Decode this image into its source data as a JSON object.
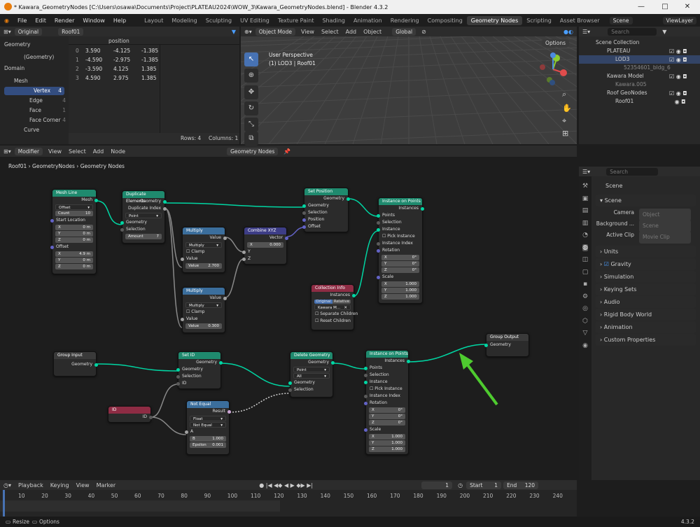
{
  "window": {
    "title": "* Kawara_GeometryNodes [C:\\Users\\osawa\\Documents\\Project\\PLATEAU2024\\WOW_3\\Kawara_GeometryNodes.blend] - Blender 4.3.2",
    "minimize": "—",
    "maximize": "□",
    "close": "✕"
  },
  "menu": {
    "items": [
      "File",
      "Edit",
      "Render",
      "Window",
      "Help"
    ],
    "workspaces": [
      "Layout",
      "Modeling",
      "Sculpting",
      "UV Editing",
      "Texture Paint",
      "Shading",
      "Animation",
      "Rendering",
      "Compositing",
      "Geometry Nodes",
      "Scripting",
      "Asset Browser"
    ],
    "active_workspace": "Geometry Nodes",
    "scene": "Scene",
    "view_layer": "ViewLayer"
  },
  "spreadsheet": {
    "mode": "Original",
    "object": "Roof01",
    "sidebar": {
      "geometry_label": "Geometry",
      "geometry_item": "(Geometry)",
      "domain_label": "Domain",
      "mesh": "Mesh",
      "items": [
        {
          "name": "Vertex",
          "count": "4"
        },
        {
          "name": "Edge",
          "count": "4"
        },
        {
          "name": "Face",
          "count": "1"
        },
        {
          "name": "Face Corner",
          "count": "4"
        }
      ],
      "curve": "Curve"
    },
    "column": "position",
    "rows": [
      [
        "0",
        "3.590",
        "-4.125",
        "-1.385"
      ],
      [
        "1",
        "-4.590",
        "-2.975",
        "-1.385"
      ],
      [
        "2",
        "-3.590",
        "4.125",
        "1.385"
      ],
      [
        "3",
        "4.590",
        "2.975",
        "1.385"
      ]
    ],
    "footer": {
      "rows": "Rows: 4",
      "columns": "Columns: 1"
    }
  },
  "viewport": {
    "mode": "Object Mode",
    "menus": [
      "View",
      "Select",
      "Add",
      "Object"
    ],
    "transform": "Global",
    "options": "Options",
    "perspective": "User Perspective",
    "collection": "(1) LOD3 | Roof01"
  },
  "outliner": {
    "search_placeholder": "Search",
    "title": "Scene Collection",
    "items": [
      {
        "name": "PLATEAU",
        "level": 0
      },
      {
        "name": "LOD3",
        "level": 1
      },
      {
        "name": "52354601_bldg_6",
        "level": 2
      },
      {
        "name": "Kawara Model",
        "level": 0
      },
      {
        "name": "Kawara.005",
        "level": 1
      },
      {
        "name": "Roof GeoNodes",
        "level": 0
      },
      {
        "name": "Roof01",
        "level": 1
      }
    ]
  },
  "properties": {
    "search_placeholder": "Search",
    "scene_name": "Scene",
    "scene_section": "Scene",
    "fields": [
      {
        "label": "Camera",
        "value": "Object"
      },
      {
        "label": "Background ...",
        "value": "Scene"
      },
      {
        "label": "Active Clip",
        "value": "Movie Clip"
      }
    ],
    "sections": [
      "Units",
      "Gravity",
      "Simulation",
      "Keying Sets",
      "Audio",
      "Rigid Body World",
      "Animation",
      "Custom Properties"
    ]
  },
  "node_editor": {
    "mode": "Modifier",
    "menus": [
      "View",
      "Select",
      "Add",
      "Node"
    ],
    "tree_name": "Geometry Nodes",
    "breadcrumb": [
      "Roof01",
      "GeometryNodes",
      "Geometry Nodes"
    ],
    "mesh_line": {
      "title": "Mesh Line",
      "out": "Mesh",
      "mode": "Offset",
      "count_label": "Count",
      "count": "10",
      "start": "Start Location",
      "sx": "0 m",
      "sy": "0 m",
      "sz": "0 m",
      "offset": "Offset",
      "ox": "4.9 m",
      "oy": "0 m",
      "oz": "0 m"
    },
    "dup": {
      "title": "Duplicate Elements",
      "geo": "Geometry",
      "idx": "Duplicate Index",
      "domain": "Point",
      "in_geo": "Geometry",
      "sel": "Selection",
      "amount": "Amount",
      "amount_v": "7"
    },
    "mul1": {
      "title": "Multiply",
      "out": "Value",
      "op": "Multiply",
      "clamp": "Clamp",
      "val": "Value",
      "v2": "2.700"
    },
    "mul2": {
      "title": "Multiply",
      "out": "Value",
      "op": "Multiply",
      "clamp": "Clamp",
      "val": "Value",
      "v2": "0.300"
    },
    "comb": {
      "title": "Combine XYZ",
      "out": "Vector",
      "x": "X",
      "xv": "0.000",
      "y": "Y",
      "z": "Z"
    },
    "setpos": {
      "title": "Set Position",
      "out": "Geometry",
      "geo": "Geometry",
      "sel": "Selection",
      "pos": "Position",
      "off": "Offset"
    },
    "iop1": {
      "title": "Instance on Points",
      "out": "Instances",
      "pts": "Points",
      "sel": "Selection",
      "inst": "Instance",
      "pick": "Pick Instance",
      "idx": "Instance Index",
      "rot": "Rotation",
      "rx": "0°",
      "ry": "0°",
      "rz": "0°",
      "scale": "Scale",
      "sx": "1.000",
      "sy": "1.000",
      "sz": "1.000"
    },
    "coll": {
      "title": "Collection Info",
      "out": "Instances",
      "orig": "Original",
      "rel": "Relative",
      "name": "Kawara M...",
      "sep": "Separate Children",
      "reset": "Reset Children"
    },
    "gin": {
      "title": "Group Input",
      "out": "Geometry"
    },
    "setid": {
      "title": "Set ID",
      "out": "Geometry",
      "geo": "Geometry",
      "sel": "Selection",
      "id": "ID"
    },
    "del": {
      "title": "Delete Geometry",
      "out": "Geometry",
      "dom": "Point",
      "mode": "All",
      "geo": "Geometry",
      "sel": "Selection"
    },
    "iop2": {
      "title": "Instance on Points",
      "out": "Instances",
      "pts": "Points",
      "sel": "Selection",
      "inst": "Instance",
      "pick": "Pick Instance",
      "idx": "Instance Index",
      "rot": "Rotation",
      "rx": "0°",
      "ry": "0°",
      "rz": "0°",
      "scale": "Scale",
      "sx": "1.000",
      "sy": "1.000",
      "sz": "1.000"
    },
    "gout": {
      "title": "Group Output",
      "in": "Geometry"
    },
    "idn": {
      "title": "ID",
      "out": "ID"
    },
    "neq": {
      "title": "Not Equal",
      "out": "Result",
      "type": "Float",
      "op": "Not Equal",
      "a": "A",
      "b": "B",
      "bv": "1.000",
      "eps": "Epsilon",
      "ev": "0.001"
    },
    "xyz": [
      "X",
      "Y",
      "Z"
    ]
  },
  "timeline": {
    "menus": [
      "Playback",
      "Keying",
      "View",
      "Marker"
    ],
    "frame": "1",
    "start_label": "Start",
    "start": "1",
    "end_label": "End",
    "end": "120",
    "ticks": [
      "10",
      "20",
      "30",
      "40",
      "50",
      "60",
      "70",
      "80",
      "90",
      "100",
      "110",
      "120",
      "130",
      "140",
      "150",
      "160",
      "170",
      "180",
      "190",
      "200",
      "210",
      "220",
      "230",
      "240"
    ]
  },
  "statusbar": {
    "resize": "Resize",
    "options": "Options",
    "version": "4.3.2"
  },
  "colors": {
    "geometry_header": "#1f8a6e",
    "input_header": "#2d7a8f",
    "utility_header": "#3b6e9c",
    "input_red": "#8e2c44",
    "link": "#00d6a3",
    "arrow": "#4ecb2f"
  }
}
